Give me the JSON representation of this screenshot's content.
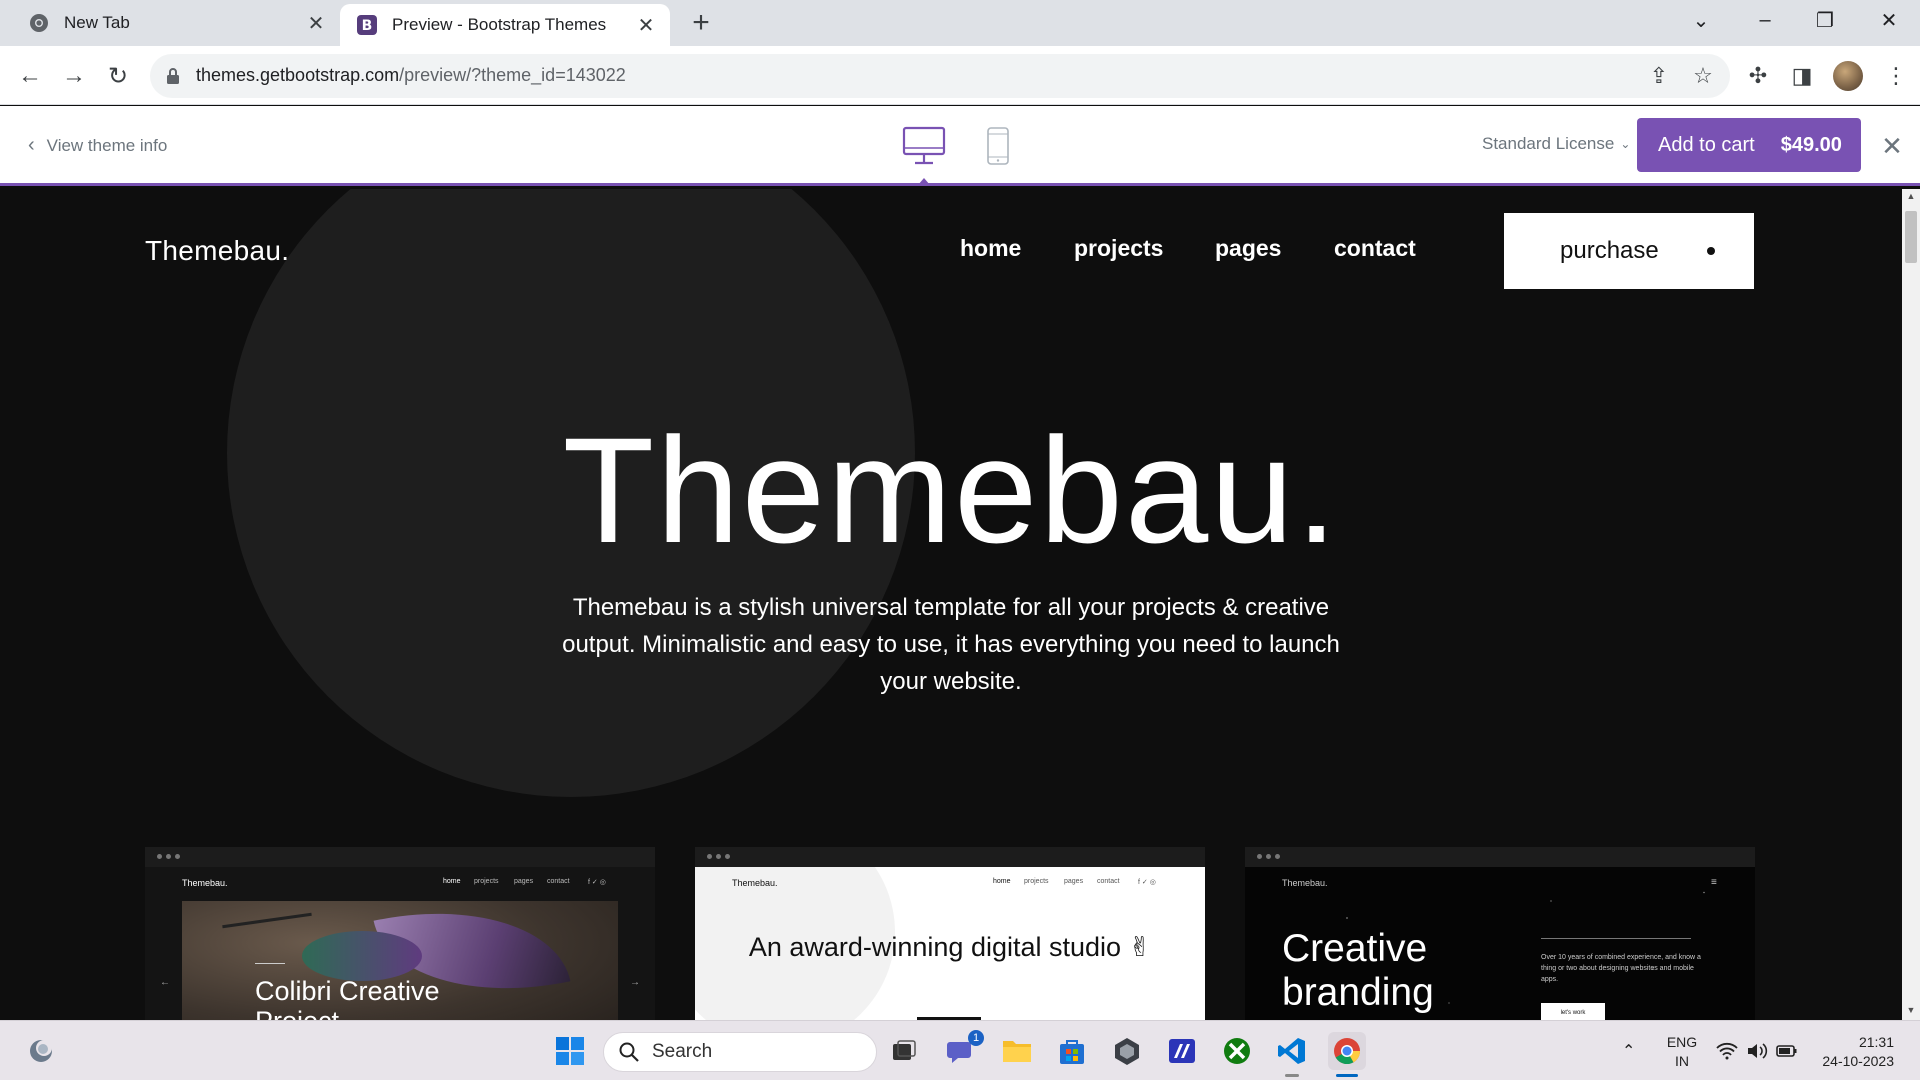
{
  "browser": {
    "tabs": [
      {
        "title": "New Tab",
        "icon": "chrome-icon",
        "active": false
      },
      {
        "title": "Preview - Bootstrap Themes",
        "icon": "bootstrap-icon",
        "active": true
      }
    ],
    "url_host": "themes.getbootstrap.com",
    "url_path": "/preview/?theme_id=143022"
  },
  "preview_bar": {
    "view_info": "View theme info",
    "license": "Standard License",
    "cart_label": "Add to cart",
    "cart_price": "$49.00",
    "accent": "#7952b3"
  },
  "site": {
    "logo": "Themebau.",
    "nav": [
      "home",
      "projects",
      "pages",
      "contact"
    ],
    "purchase": "purchase",
    "hero_title": "Themebau.",
    "hero_sub": "Themebau is a stylish universal template for all your projects & creative output. Minimalistic and easy to use, it has everything you need to launch your website.",
    "cards": [
      {
        "title": "Colibri Creative Project"
      },
      {
        "title": "An award-winning digital studio ✌"
      },
      {
        "title": "Creative branding",
        "desc": "Over 10 years of combined experience, and know a thing or two about designing websites and mobile apps.",
        "button": "let's work"
      }
    ],
    "mini_nav": [
      "home",
      "projects",
      "pages",
      "contact"
    ]
  },
  "taskbar": {
    "search": "Search",
    "teams_badge": "1",
    "lang_top": "ENG",
    "lang_bottom": "IN",
    "time": "21:31",
    "date": "24-10-2023"
  }
}
